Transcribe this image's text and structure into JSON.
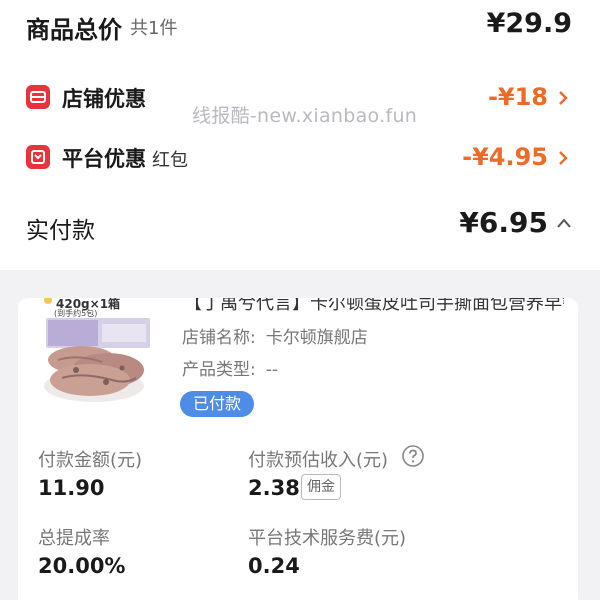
{
  "summary": {
    "title": "商品总价",
    "count": "共1件",
    "total": "¥29.9"
  },
  "discounts": [
    {
      "label": "店铺优惠",
      "sub": "",
      "value": "-¥18",
      "icon": "shop-coupon-icon"
    },
    {
      "label": "平台优惠",
      "sub": "红包",
      "value": "-¥4.95",
      "icon": "red-packet-icon"
    }
  ],
  "watermark": "线报酷-new.xianbao.fun",
  "payment": {
    "label": "实付款",
    "value": "¥6.95"
  },
  "order": {
    "thumb_text1": "420g×1箱",
    "thumb_text2": "(到手约5包)",
    "title": "【丁禹兮代言】卡尔顿蛋皮吐司手撕面包营养早餐",
    "shop_label": "店铺名称:",
    "shop_name": "卡尔顿旗舰店",
    "type_label": "产品类型:",
    "type_value": "--",
    "status": "已付款"
  },
  "stats": {
    "pay_amount_label": "付款金额(元)",
    "pay_amount_value": "11.90",
    "est_income_label": "付款预估收入(元)",
    "est_income_value": "2.38",
    "commission_tag": "佣金",
    "rate_label": "总提成率",
    "rate_value": "20.00%",
    "fee_label": "平台技术服务费(元)",
    "fee_value": "0.24"
  },
  "colors": {
    "accent_orange": "#ec6b28",
    "icon_red": "#e8323c",
    "badge_blue": "#4e8ce8"
  }
}
